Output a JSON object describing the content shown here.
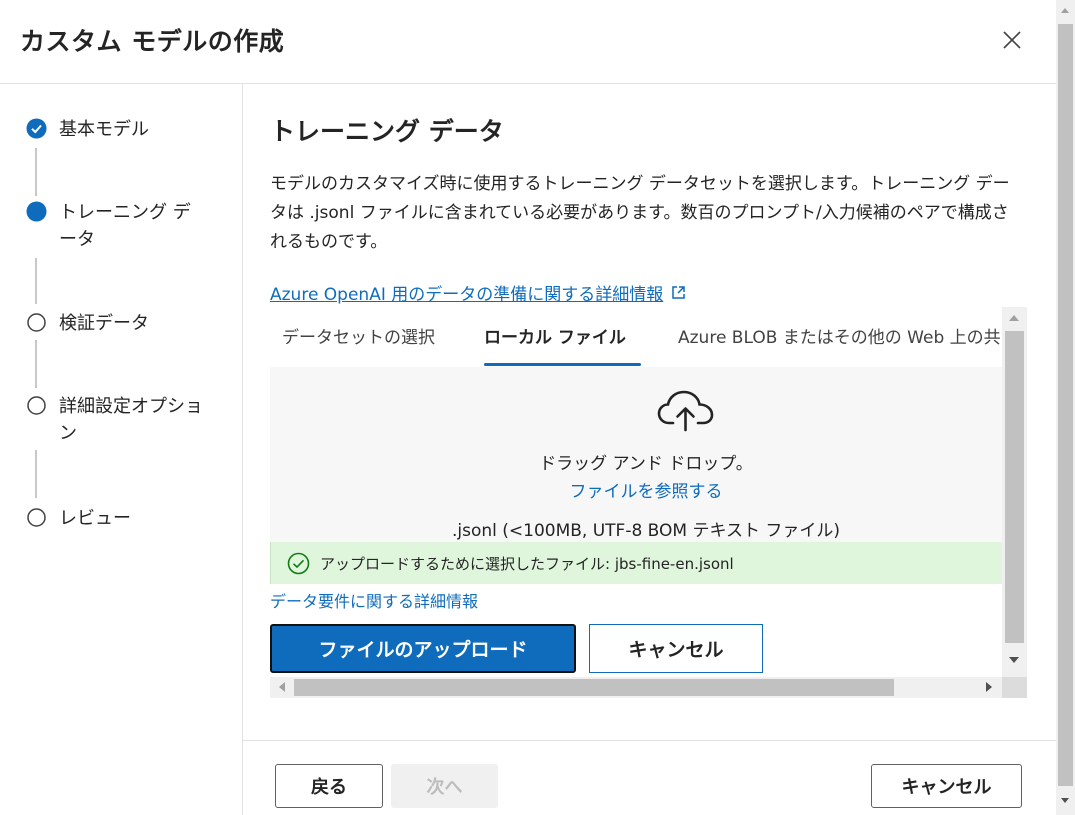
{
  "dialog": {
    "title": "カスタム モデルの作成"
  },
  "steps": [
    {
      "label": "基本モデル",
      "state": "completed"
    },
    {
      "label": "トレーニング データ",
      "state": "current"
    },
    {
      "label": "検証データ",
      "state": "pending"
    },
    {
      "label": "詳細設定オプション",
      "state": "pending"
    },
    {
      "label": "レビュー",
      "state": "pending"
    }
  ],
  "main": {
    "title": "トレーニング データ",
    "description": "モデルのカスタマイズ時に使用するトレーニング データセットを選択します。トレーニング データは .jsonl ファイルに含まれている必要があります。数百のプロンプト/入力候補のペアで構成されるものです。",
    "info_link": "Azure OpenAI 用のデータの準備に関する詳細情報"
  },
  "tabs": [
    {
      "label": "データセットの選択",
      "active": false
    },
    {
      "label": "ローカル ファイル",
      "active": true
    },
    {
      "label": "Azure BLOB またはその他の Web 上の共",
      "active": false
    }
  ],
  "dropzone": {
    "drag_text": "ドラッグ アンド ドロップ。",
    "browse_link": "ファイルを参照する",
    "file_hint": ".jsonl (<100MB, UTF-8 BOM テキスト ファイル)"
  },
  "upload_status": {
    "message": "アップロードするために選択したファイル: jbs-fine-en.jsonl"
  },
  "requirements_link": "データ要件に関する詳細情報",
  "upload_actions": {
    "upload_label": "ファイルのアップロード",
    "cancel_label": "キャンセル"
  },
  "footer": {
    "back_label": "戻る",
    "next_label": "次へ",
    "cancel_label": "キャンセル"
  },
  "colors": {
    "accent": "#0f6cbd",
    "success_bg": "#dff6dd",
    "success_icon": "#107c10"
  }
}
